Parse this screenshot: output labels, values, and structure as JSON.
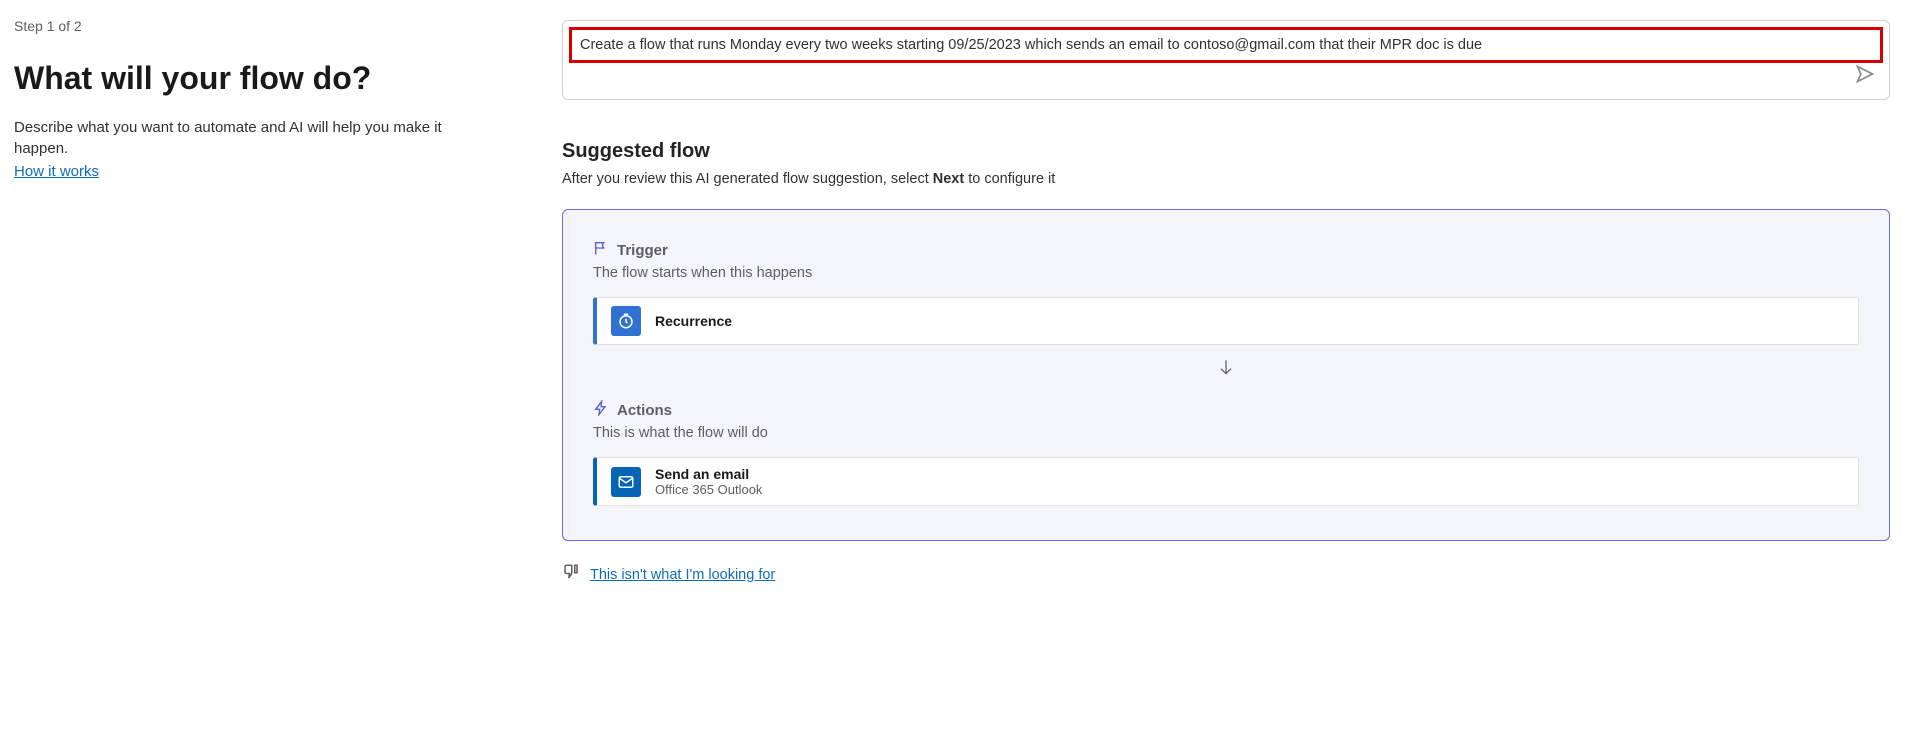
{
  "left": {
    "step": "Step 1 of 2",
    "heading": "What will your flow do?",
    "subtitle": "Describe what you want to automate and AI will help you make it happen.",
    "how_link": "How it works"
  },
  "prompt": {
    "text": "Create a flow that runs Monday every two weeks starting 09/25/2023 which sends an email to contoso@gmail.com that their MPR doc is due"
  },
  "suggested": {
    "title": "Suggested flow",
    "subtitle_prefix": "After you review this AI generated flow suggestion, select ",
    "subtitle_bold": "Next",
    "subtitle_suffix": " to configure it"
  },
  "trigger": {
    "label": "Trigger",
    "desc": "The flow starts when this happens",
    "card_title": "Recurrence"
  },
  "actions": {
    "label": "Actions",
    "desc": "This is what the flow will do",
    "card_title": "Send an email",
    "card_sub": "Office 365 Outlook"
  },
  "feedback": {
    "not_looking": "This isn't what I'm looking for"
  }
}
